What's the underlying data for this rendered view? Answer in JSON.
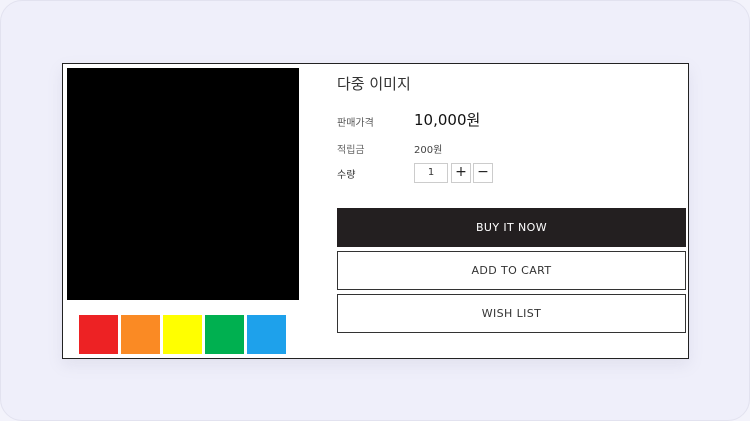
{
  "product": {
    "title": "다중 이미지",
    "price_label": "판매가격",
    "price_value": "10,000원",
    "points_label": "적립금",
    "points_value": "200원",
    "quantity_label": "수량",
    "quantity_value": "1",
    "plus_symbol": "+",
    "minus_symbol": "−"
  },
  "gallery": {
    "main_image_color": "#000000",
    "thumbnail_colors": [
      "#ed2224",
      "#fa8a24",
      "#ffff00",
      "#00b050",
      "#1ea1eb"
    ]
  },
  "buttons": {
    "buy_now": "BUY IT NOW",
    "add_to_cart": "ADD TO CART",
    "wish_list": "WISH LIST"
  }
}
